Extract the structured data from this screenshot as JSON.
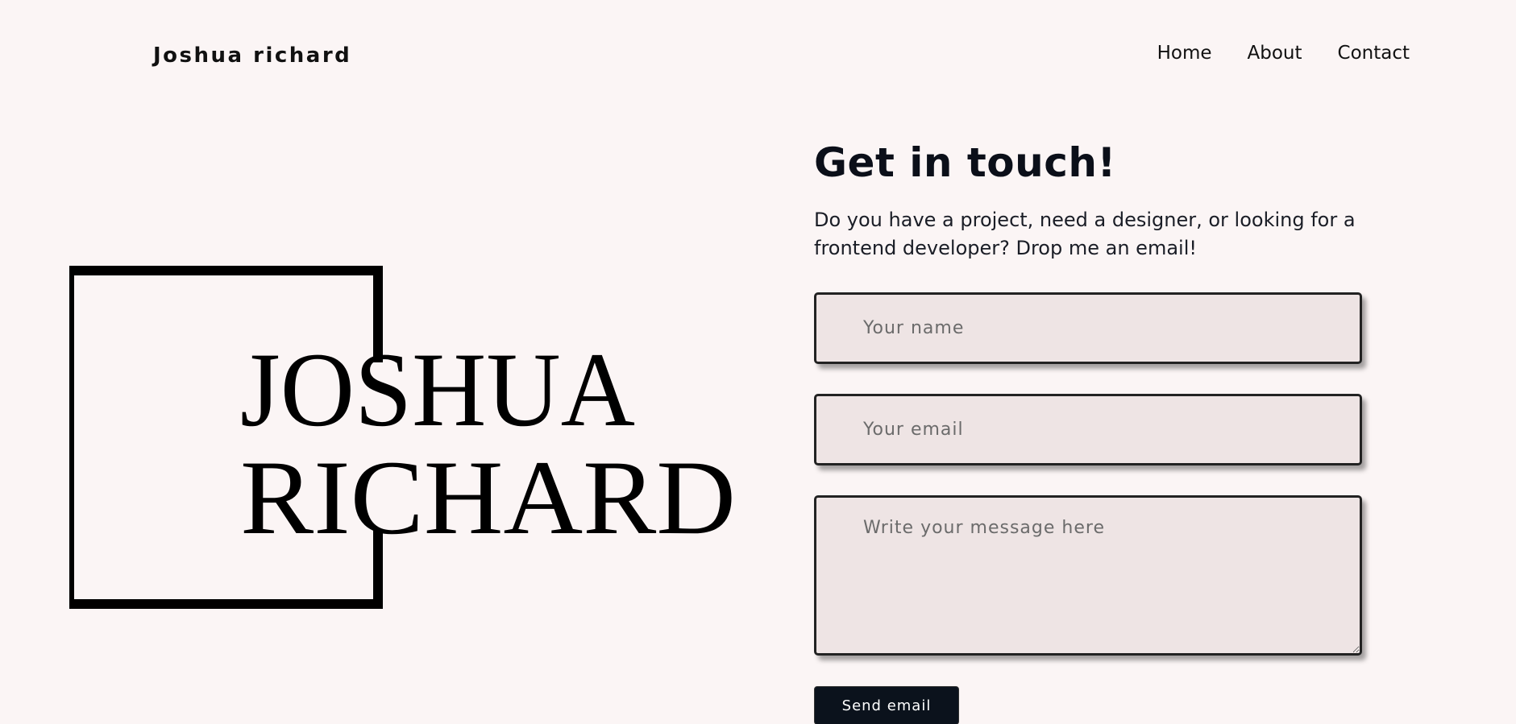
{
  "header": {
    "brand": "Joshua richard",
    "nav": [
      {
        "label": "Home"
      },
      {
        "label": "About"
      },
      {
        "label": "Contact"
      }
    ]
  },
  "logo": {
    "line1": "JOSHUA",
    "line2": "RICHARD"
  },
  "contact": {
    "title": "Get in touch!",
    "intro": "Do you have a project, need a designer, or looking for a frontend developer? Drop me an email!",
    "name_placeholder": "Your name",
    "email_placeholder": "Your email",
    "message_placeholder": "Write your message here",
    "send_label": "Send email"
  },
  "colors": {
    "background": "#fbf5f5",
    "field_background": "#eee4e4",
    "button_background": "#0b121c"
  }
}
